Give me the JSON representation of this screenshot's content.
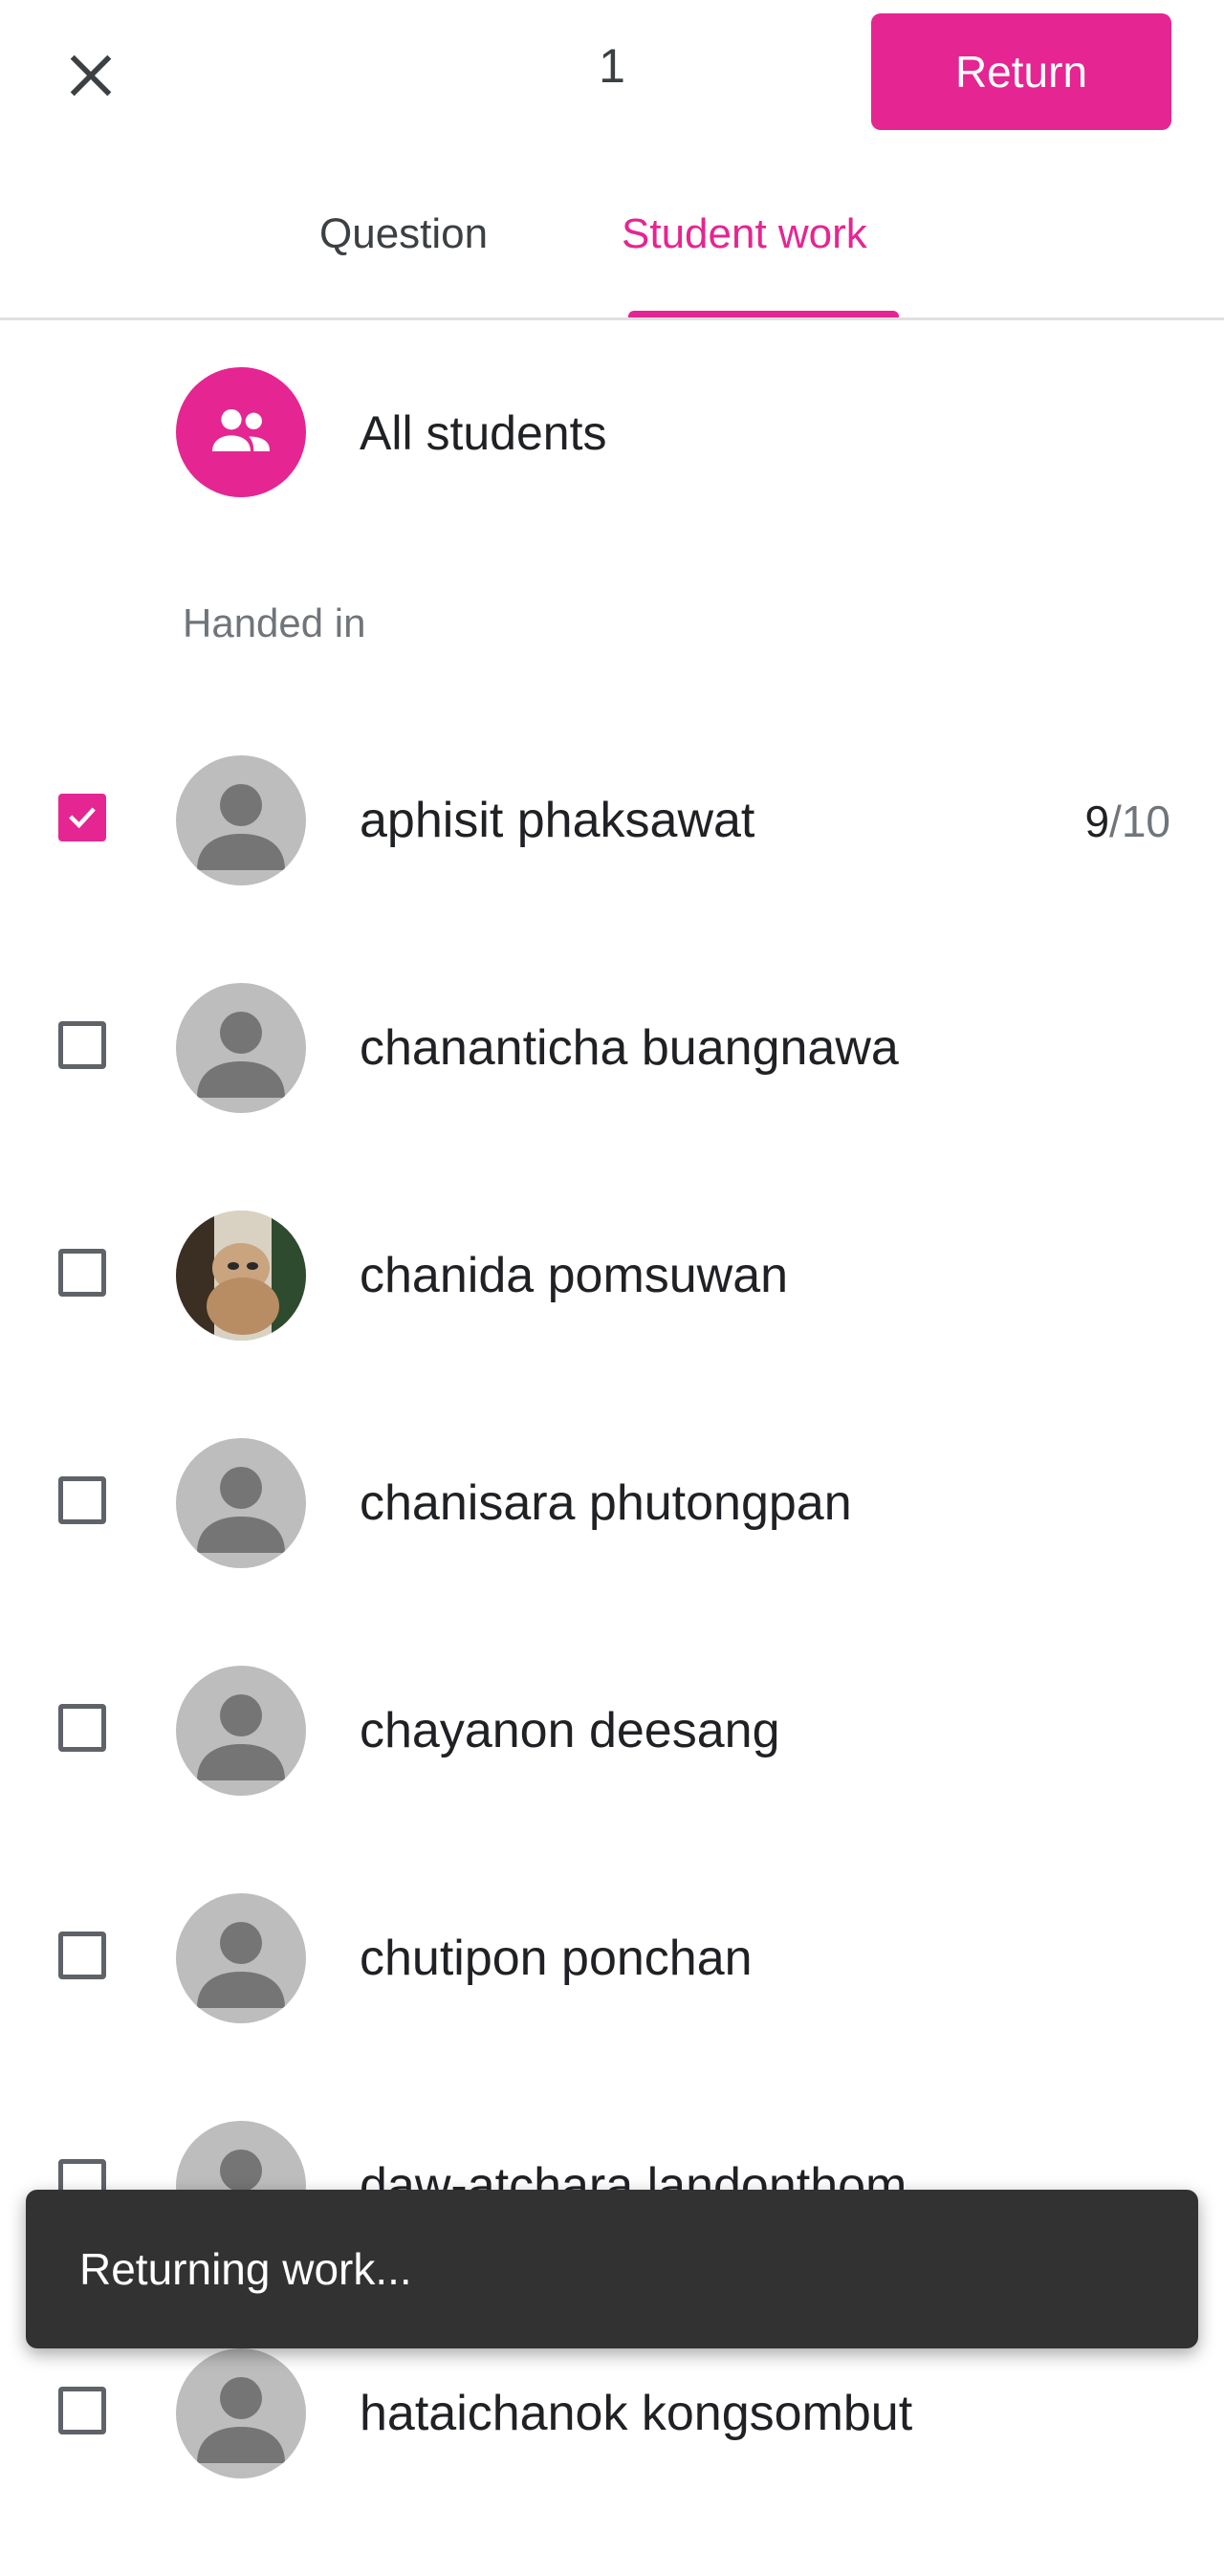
{
  "header": {
    "close_icon": "close-icon",
    "count": "1",
    "return_label": "Return"
  },
  "tabs": [
    {
      "label": "Question",
      "selected": false
    },
    {
      "label": "Student work",
      "selected": true
    }
  ],
  "all_students": {
    "icon": "group-icon",
    "label": "All students"
  },
  "section": {
    "handed_in_label": "Handed in"
  },
  "students": [
    {
      "name": "aphisit phaksawat",
      "checked": true,
      "grade": "9",
      "grade_max": "/10",
      "avatar": "default-avatar"
    },
    {
      "name": "chananticha buangnawa",
      "checked": false,
      "avatar": "default-avatar"
    },
    {
      "name": "chanida pomsuwan",
      "checked": false,
      "avatar": "photo-avatar"
    },
    {
      "name": "chanisara phutongpan",
      "checked": false,
      "avatar": "default-avatar"
    },
    {
      "name": "chayanon deesang",
      "checked": false,
      "avatar": "default-avatar"
    },
    {
      "name": "chutipon ponchan",
      "checked": false,
      "avatar": "default-avatar"
    },
    {
      "name": "daw-atchara landonthom",
      "checked": false,
      "avatar": "default-avatar"
    },
    {
      "name": "hataichanok kongsombut",
      "checked": false,
      "avatar": "default-avatar"
    }
  ],
  "snackbar": {
    "text": "Returning work..."
  },
  "colors": {
    "accent": "#e52592",
    "snackbar_bg": "#323232",
    "avatar_bg": "#bdbdbd",
    "avatar_fg": "#757575"
  }
}
